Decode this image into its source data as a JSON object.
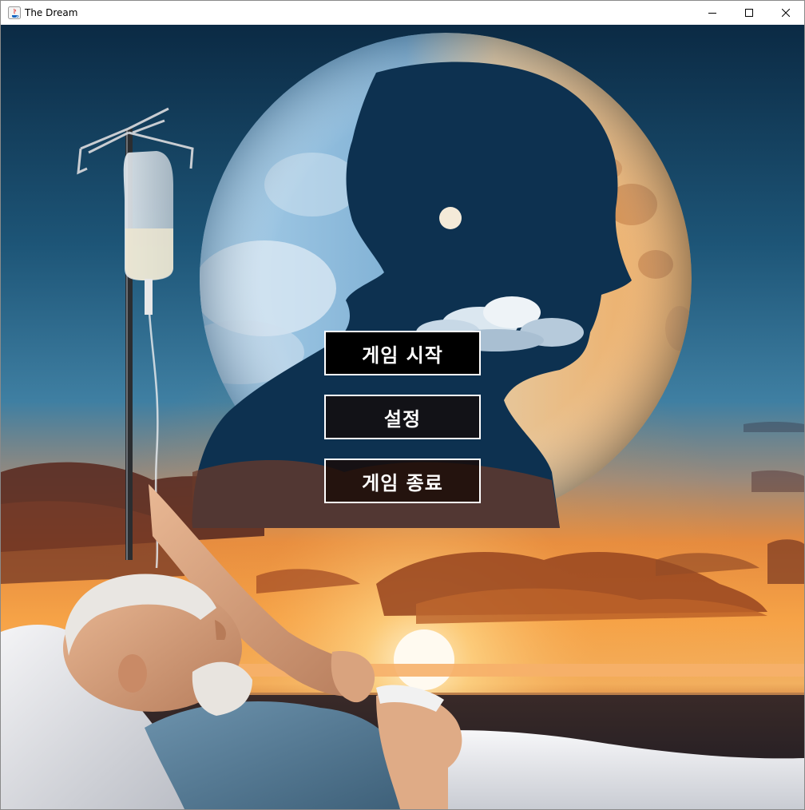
{
  "window": {
    "title": "The Dream",
    "app_icon": "java-icon",
    "controls": {
      "minimize_icon": "minimize-icon",
      "maximize_icon": "maximize-icon",
      "close_icon": "close-icon"
    }
  },
  "menu": {
    "start_label": "게임 시작",
    "settings_label": "설정",
    "quit_label": "게임 종료"
  },
  "colors": {
    "sky_top": "#0e2f4a",
    "sky_mid": "#2f6f93",
    "sunset_orange": "#f0902c",
    "sun_glow": "#ffe6a8",
    "moon_blue": "#8fbde0",
    "moon_orange": "#f2b56a",
    "silhouette": "#0d3150",
    "button_bg": "#000000",
    "button_border": "#ffffff",
    "button_text": "#ffffff"
  }
}
